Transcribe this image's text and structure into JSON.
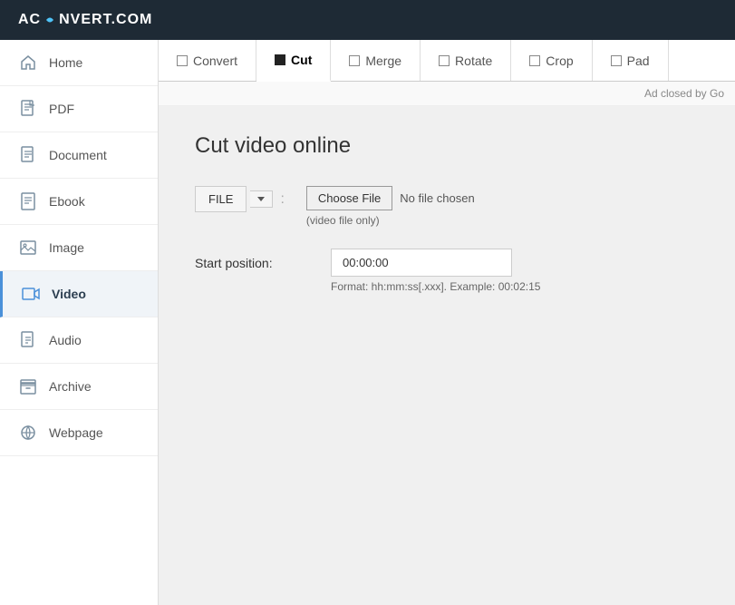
{
  "header": {
    "logo": "AC⟳NVERT.COM"
  },
  "sidebar": {
    "items": [
      {
        "id": "home",
        "label": "Home",
        "icon": "home"
      },
      {
        "id": "pdf",
        "label": "PDF",
        "icon": "pdf"
      },
      {
        "id": "document",
        "label": "Document",
        "icon": "document"
      },
      {
        "id": "ebook",
        "label": "Ebook",
        "icon": "ebook"
      },
      {
        "id": "image",
        "label": "Image",
        "icon": "image"
      },
      {
        "id": "video",
        "label": "Video",
        "icon": "video",
        "active": true
      },
      {
        "id": "audio",
        "label": "Audio",
        "icon": "audio"
      },
      {
        "id": "archive",
        "label": "Archive",
        "icon": "archive"
      },
      {
        "id": "webpage",
        "label": "Webpage",
        "icon": "webpage"
      }
    ]
  },
  "tabs": [
    {
      "id": "convert",
      "label": "Convert",
      "active": false,
      "filled": false
    },
    {
      "id": "cut",
      "label": "Cut",
      "active": true,
      "filled": true
    },
    {
      "id": "merge",
      "label": "Merge",
      "active": false,
      "filled": false
    },
    {
      "id": "rotate",
      "label": "Rotate",
      "active": false,
      "filled": false
    },
    {
      "id": "crop",
      "label": "Crop",
      "active": false,
      "filled": false
    },
    {
      "id": "pad",
      "label": "Pad",
      "active": false,
      "filled": false
    }
  ],
  "ad": {
    "text": "Ad closed by Go"
  },
  "main": {
    "title": "Cut video online",
    "file_button_label": "FILE",
    "choose_file_label": "Choose File",
    "no_file_text": "No file chosen",
    "file_hint": "(video file only)",
    "start_position_label": "Start position:",
    "start_position_value": "00:00:00",
    "format_hint": "Format: hh:mm:ss[.xxx]. Example:",
    "format_example": "00:02:15"
  }
}
